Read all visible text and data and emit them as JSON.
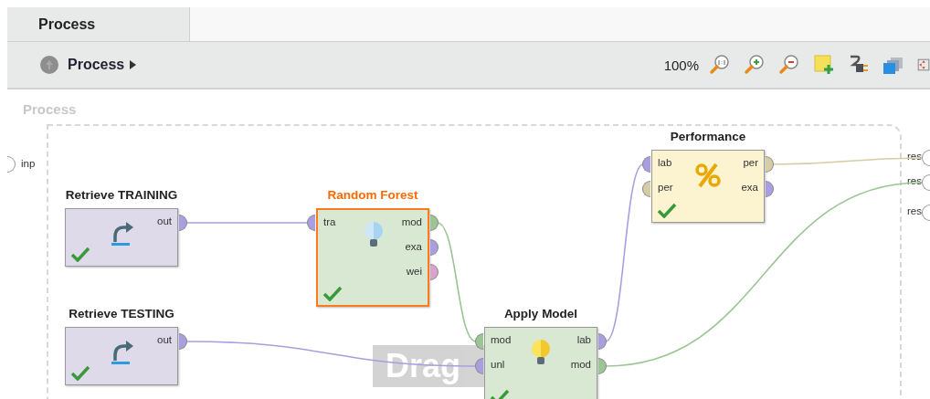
{
  "tabs": [
    {
      "label": "Process",
      "selected": true
    }
  ],
  "toolbar": {
    "breadcrumb": "Process",
    "zoom": "100%"
  },
  "canvas": {
    "label": "Process",
    "inputs": [
      {
        "label": "inp"
      }
    ],
    "outputs": [
      {
        "label": "res"
      },
      {
        "label": "res"
      },
      {
        "label": "res"
      }
    ],
    "drag_hint": "Drag",
    "operators": [
      {
        "name": "Retrieve TRAINING",
        "kind": "retrieve",
        "selected": false,
        "done": true,
        "outputs": [
          {
            "label": "out",
            "color": "#a99ee0"
          }
        ]
      },
      {
        "name": "Retrieve TESTING",
        "kind": "retrieve",
        "selected": false,
        "done": true,
        "outputs": [
          {
            "label": "out",
            "color": "#a99ee0"
          }
        ]
      },
      {
        "name": "Random Forest",
        "kind": "learner",
        "selected": true,
        "done": true,
        "inputs": [
          {
            "label": "tra",
            "color": "#a99ee0"
          }
        ],
        "outputs": [
          {
            "label": "mod",
            "color": "#9cc596"
          },
          {
            "label": "exa",
            "color": "#a99ee0"
          },
          {
            "label": "wei",
            "color": "#d9a3cc"
          }
        ]
      },
      {
        "name": "Performance",
        "kind": "performance",
        "selected": false,
        "done": true,
        "inputs": [
          {
            "label": "lab",
            "color": "#a99ee0"
          },
          {
            "label": "per",
            "color": "#d6cda6"
          }
        ],
        "outputs": [
          {
            "label": "per",
            "color": "#d6cda6"
          },
          {
            "label": "exa",
            "color": "#a99ee0"
          }
        ]
      },
      {
        "name": "Apply Model",
        "kind": "apply",
        "selected": false,
        "done": true,
        "inputs": [
          {
            "label": "mod",
            "color": "#9cc596"
          },
          {
            "label": "unl",
            "color": "#a99ee0"
          }
        ],
        "outputs": [
          {
            "label": "lab",
            "color": "#a99ee0"
          },
          {
            "label": "mod",
            "color": "#9cc596"
          }
        ]
      }
    ]
  }
}
